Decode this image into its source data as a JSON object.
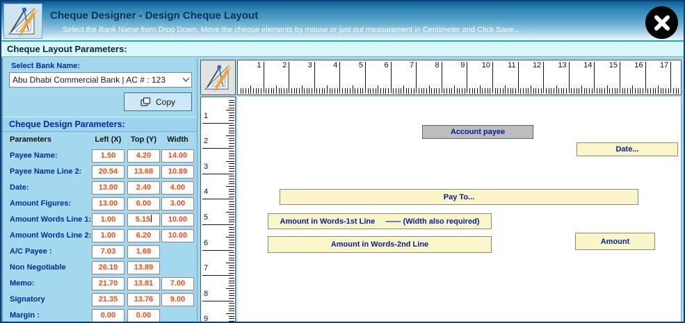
{
  "window": {
    "title": "Cheque Designer - Design Cheque Layout",
    "subtitle": "Select the Bank Name from Drop Down, Move the cheque elements by mouse or just put measurement in Centimeter and Click Save...",
    "close_glyph": "✕"
  },
  "section": {
    "layout_params_header": "Cheque Layout Parameters:"
  },
  "bank": {
    "label": "Select Bank Name:",
    "selected": "Abu Dhabi Commercial Bank | AC # :  123",
    "copy_label": "Copy"
  },
  "design_params": {
    "header": "Cheque Design Parameters:",
    "columns": [
      "Parameters",
      "Left (X)",
      "Top (Y)",
      "Width"
    ],
    "rows": [
      {
        "label": "Payee Name:",
        "left": "1.50",
        "top": "4.20",
        "width": "14.00"
      },
      {
        "label": "Payee Name Line 2:",
        "left": "20.54",
        "top": "13.68",
        "width": "10.89"
      },
      {
        "label": "Date:",
        "left": "13.00",
        "top": "2.40",
        "width": "4.00"
      },
      {
        "label": "Amount Figures:",
        "left": "13.00",
        "top": "6.00",
        "width": "3.00"
      },
      {
        "label": "Amount Words Line 1:",
        "left": "1.00",
        "top": "5.15",
        "width": "10.00",
        "caret": "top"
      },
      {
        "label": "Amount Words Line 2:",
        "left": "1.00",
        "top": "6.20",
        "width": "10.00"
      },
      {
        "label": "A/C Payee :",
        "left": "7.03",
        "top": "1.68",
        "width": ""
      },
      {
        "label": "Non Negotiable",
        "left": "26.19",
        "top": "13.89",
        "width": ""
      },
      {
        "label": "Memo:",
        "left": "21.70",
        "top": "13.81",
        "width": "7.00"
      },
      {
        "label": "Signatory",
        "left": "21.35",
        "top": "13.76",
        "width": "9.00"
      },
      {
        "label": "Margin :",
        "left": "0.00",
        "top": "0.00",
        "width": ""
      }
    ]
  },
  "rulers": {
    "unit": "cm",
    "horizontal_numbers": [
      1,
      2,
      3,
      4,
      5,
      6,
      7,
      8,
      9,
      10,
      11,
      12,
      13,
      14,
      15,
      16,
      17
    ],
    "vertical_numbers": [
      1,
      2,
      3,
      4,
      5,
      6,
      7,
      8,
      9
    ]
  },
  "cheque_elements": [
    {
      "id": "account-payee",
      "label": "Account payee",
      "style": "gray"
    },
    {
      "id": "date",
      "label": "Date...",
      "style": "cream"
    },
    {
      "id": "pay-to",
      "label": "Pay To...",
      "style": "cream"
    },
    {
      "id": "amount-words-line-1",
      "label": "Amount in Words-1st Line     —— (Width also required)",
      "style": "cream"
    },
    {
      "id": "amount-words-line-2",
      "label": "Amount in Words-2nd Line",
      "style": "cream"
    },
    {
      "id": "amount",
      "label": "Amount",
      "style": "cream"
    }
  ],
  "colors": {
    "panel_bg": "#A3D8EE",
    "label_text": "#002D9C",
    "value_text": "#FF4713",
    "cream": "#FBF5CA",
    "gray_box": "#BDBDBD",
    "header_top": "#0B5E97",
    "band_bg": "#D9F7FB"
  }
}
